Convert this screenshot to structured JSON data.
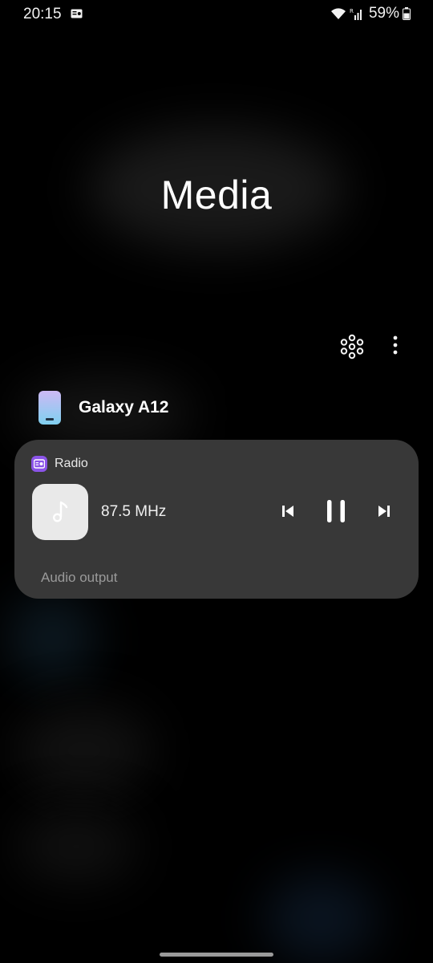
{
  "status_bar": {
    "time": "20:15",
    "radio_icon": "radio-icon",
    "wifi_icon": "wifi-icon",
    "signal_icon": "signal-icon",
    "battery_percent": "59%",
    "battery_icon": "battery-icon"
  },
  "panel": {
    "title": "Media",
    "connect_icon": "device-connect-icon",
    "more_icon": "more-options-icon"
  },
  "device": {
    "name": "Galaxy A12",
    "icon": "phone-icon"
  },
  "media_card": {
    "app_name": "Radio",
    "app_icon": "radio-app-icon",
    "album_art_icon": "music-note-icon",
    "track_title": "87.5 MHz",
    "controls": {
      "previous_icon": "skip-previous-icon",
      "pause_icon": "pause-icon",
      "next_icon": "skip-next-icon"
    },
    "audio_output_label": "Audio output"
  },
  "colors": {
    "background": "#000000",
    "card": "#383838",
    "app_icon_accent": "#8b54e8",
    "phone_gradient_top": "#cdb9f4",
    "phone_gradient_bottom": "#7fd0f0"
  }
}
